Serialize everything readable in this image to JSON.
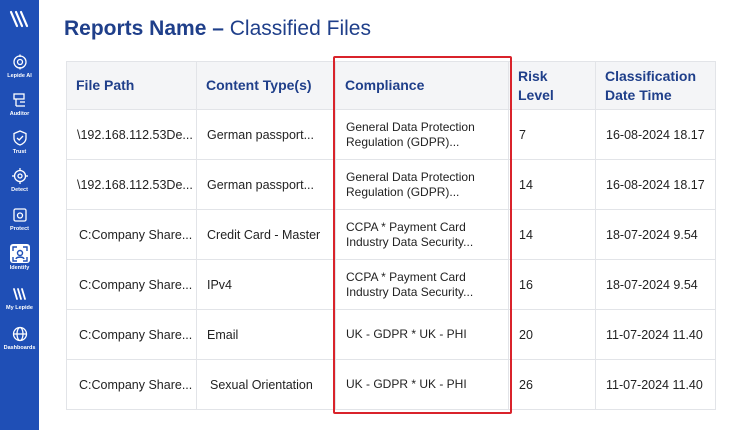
{
  "sidebar": {
    "items": [
      {
        "label": "Lepide AI",
        "icon": "brain-icon"
      },
      {
        "label": "Auditor",
        "icon": "auditor-icon"
      },
      {
        "label": "Trust",
        "icon": "shield-check-icon"
      },
      {
        "label": "Detect",
        "icon": "crosshair-icon"
      },
      {
        "label": "Protect",
        "icon": "protect-icon"
      },
      {
        "label": "Identify",
        "icon": "identify-icon"
      },
      {
        "label": "My Lepide",
        "icon": "my-lepide-icon"
      },
      {
        "label": "Dashboards",
        "icon": "globe-icon"
      }
    ],
    "active": "Identify"
  },
  "page": {
    "title_bold": "Reports Name",
    "title_sep": " – ",
    "title_light": "Classified Files"
  },
  "table": {
    "headers": [
      "File Path",
      "Content Type(s)",
      "Compliance",
      "Risk Level",
      "Classification Date Time"
    ],
    "rows": [
      [
        "\\192.168.112.53De...",
        "German passport...",
        "General Data Protection Regulation (GDPR)...",
        "7",
        "16-08-2024 18.17"
      ],
      [
        "\\192.168.112.53De...",
        "German passport...",
        "General Data Protection Regulation (GDPR)...",
        "14",
        "16-08-2024 18.17"
      ],
      [
        "C:Company Share...",
        "Credit Card - Master",
        "CCPA * Payment Card Industry Data Security...",
        "14",
        "18-07-2024 9.54"
      ],
      [
        "C:Company Share...",
        "IPv4",
        "CCPA * Payment Card Industry Data Security...",
        "16",
        "18-07-2024 9.54"
      ],
      [
        "C:Company Share...",
        "Email",
        "UK - GDPR * UK - PHI",
        "20",
        "11-07-2024 11.40"
      ],
      [
        "C:Company Share...",
        "Sexual Orientation",
        "UK - GDPR * UK - PHI",
        "26",
        "11-07-2024 11.40"
      ]
    ]
  },
  "colors": {
    "sidebar": "#1f4fb6",
    "title": "#1f3f8a",
    "highlight": "#d9232b"
  }
}
